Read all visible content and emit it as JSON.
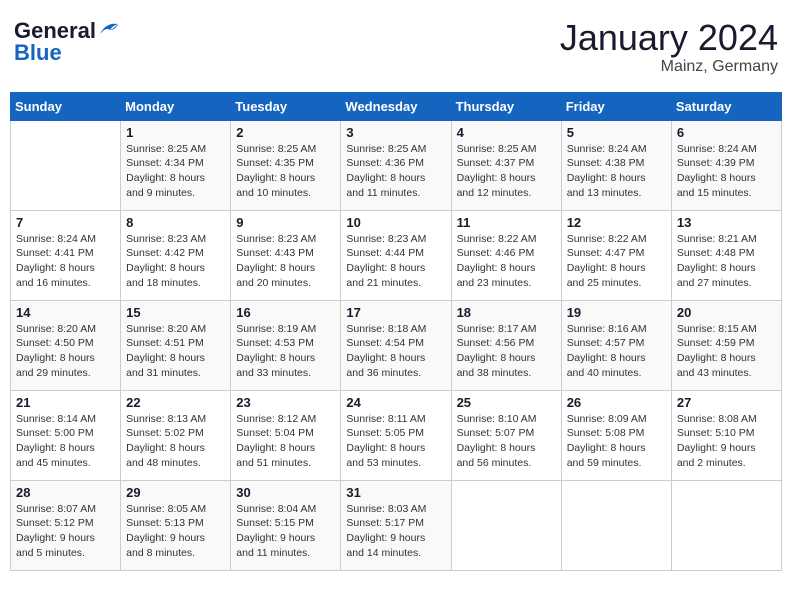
{
  "header": {
    "logo_general": "General",
    "logo_blue": "Blue",
    "month_title": "January 2024",
    "location": "Mainz, Germany"
  },
  "weekdays": [
    "Sunday",
    "Monday",
    "Tuesday",
    "Wednesday",
    "Thursday",
    "Friday",
    "Saturday"
  ],
  "weeks": [
    [
      {
        "day": "",
        "sunrise": "",
        "sunset": "",
        "daylight": ""
      },
      {
        "day": "1",
        "sunrise": "Sunrise: 8:25 AM",
        "sunset": "Sunset: 4:34 PM",
        "daylight": "Daylight: 8 hours and 9 minutes."
      },
      {
        "day": "2",
        "sunrise": "Sunrise: 8:25 AM",
        "sunset": "Sunset: 4:35 PM",
        "daylight": "Daylight: 8 hours and 10 minutes."
      },
      {
        "day": "3",
        "sunrise": "Sunrise: 8:25 AM",
        "sunset": "Sunset: 4:36 PM",
        "daylight": "Daylight: 8 hours and 11 minutes."
      },
      {
        "day": "4",
        "sunrise": "Sunrise: 8:25 AM",
        "sunset": "Sunset: 4:37 PM",
        "daylight": "Daylight: 8 hours and 12 minutes."
      },
      {
        "day": "5",
        "sunrise": "Sunrise: 8:24 AM",
        "sunset": "Sunset: 4:38 PM",
        "daylight": "Daylight: 8 hours and 13 minutes."
      },
      {
        "day": "6",
        "sunrise": "Sunrise: 8:24 AM",
        "sunset": "Sunset: 4:39 PM",
        "daylight": "Daylight: 8 hours and 15 minutes."
      }
    ],
    [
      {
        "day": "7",
        "sunrise": "Sunrise: 8:24 AM",
        "sunset": "Sunset: 4:41 PM",
        "daylight": "Daylight: 8 hours and 16 minutes."
      },
      {
        "day": "8",
        "sunrise": "Sunrise: 8:23 AM",
        "sunset": "Sunset: 4:42 PM",
        "daylight": "Daylight: 8 hours and 18 minutes."
      },
      {
        "day": "9",
        "sunrise": "Sunrise: 8:23 AM",
        "sunset": "Sunset: 4:43 PM",
        "daylight": "Daylight: 8 hours and 20 minutes."
      },
      {
        "day": "10",
        "sunrise": "Sunrise: 8:23 AM",
        "sunset": "Sunset: 4:44 PM",
        "daylight": "Daylight: 8 hours and 21 minutes."
      },
      {
        "day": "11",
        "sunrise": "Sunrise: 8:22 AM",
        "sunset": "Sunset: 4:46 PM",
        "daylight": "Daylight: 8 hours and 23 minutes."
      },
      {
        "day": "12",
        "sunrise": "Sunrise: 8:22 AM",
        "sunset": "Sunset: 4:47 PM",
        "daylight": "Daylight: 8 hours and 25 minutes."
      },
      {
        "day": "13",
        "sunrise": "Sunrise: 8:21 AM",
        "sunset": "Sunset: 4:48 PM",
        "daylight": "Daylight: 8 hours and 27 minutes."
      }
    ],
    [
      {
        "day": "14",
        "sunrise": "Sunrise: 8:20 AM",
        "sunset": "Sunset: 4:50 PM",
        "daylight": "Daylight: 8 hours and 29 minutes."
      },
      {
        "day": "15",
        "sunrise": "Sunrise: 8:20 AM",
        "sunset": "Sunset: 4:51 PM",
        "daylight": "Daylight: 8 hours and 31 minutes."
      },
      {
        "day": "16",
        "sunrise": "Sunrise: 8:19 AM",
        "sunset": "Sunset: 4:53 PM",
        "daylight": "Daylight: 8 hours and 33 minutes."
      },
      {
        "day": "17",
        "sunrise": "Sunrise: 8:18 AM",
        "sunset": "Sunset: 4:54 PM",
        "daylight": "Daylight: 8 hours and 36 minutes."
      },
      {
        "day": "18",
        "sunrise": "Sunrise: 8:17 AM",
        "sunset": "Sunset: 4:56 PM",
        "daylight": "Daylight: 8 hours and 38 minutes."
      },
      {
        "day": "19",
        "sunrise": "Sunrise: 8:16 AM",
        "sunset": "Sunset: 4:57 PM",
        "daylight": "Daylight: 8 hours and 40 minutes."
      },
      {
        "day": "20",
        "sunrise": "Sunrise: 8:15 AM",
        "sunset": "Sunset: 4:59 PM",
        "daylight": "Daylight: 8 hours and 43 minutes."
      }
    ],
    [
      {
        "day": "21",
        "sunrise": "Sunrise: 8:14 AM",
        "sunset": "Sunset: 5:00 PM",
        "daylight": "Daylight: 8 hours and 45 minutes."
      },
      {
        "day": "22",
        "sunrise": "Sunrise: 8:13 AM",
        "sunset": "Sunset: 5:02 PM",
        "daylight": "Daylight: 8 hours and 48 minutes."
      },
      {
        "day": "23",
        "sunrise": "Sunrise: 8:12 AM",
        "sunset": "Sunset: 5:04 PM",
        "daylight": "Daylight: 8 hours and 51 minutes."
      },
      {
        "day": "24",
        "sunrise": "Sunrise: 8:11 AM",
        "sunset": "Sunset: 5:05 PM",
        "daylight": "Daylight: 8 hours and 53 minutes."
      },
      {
        "day": "25",
        "sunrise": "Sunrise: 8:10 AM",
        "sunset": "Sunset: 5:07 PM",
        "daylight": "Daylight: 8 hours and 56 minutes."
      },
      {
        "day": "26",
        "sunrise": "Sunrise: 8:09 AM",
        "sunset": "Sunset: 5:08 PM",
        "daylight": "Daylight: 8 hours and 59 minutes."
      },
      {
        "day": "27",
        "sunrise": "Sunrise: 8:08 AM",
        "sunset": "Sunset: 5:10 PM",
        "daylight": "Daylight: 9 hours and 2 minutes."
      }
    ],
    [
      {
        "day": "28",
        "sunrise": "Sunrise: 8:07 AM",
        "sunset": "Sunset: 5:12 PM",
        "daylight": "Daylight: 9 hours and 5 minutes."
      },
      {
        "day": "29",
        "sunrise": "Sunrise: 8:05 AM",
        "sunset": "Sunset: 5:13 PM",
        "daylight": "Daylight: 9 hours and 8 minutes."
      },
      {
        "day": "30",
        "sunrise": "Sunrise: 8:04 AM",
        "sunset": "Sunset: 5:15 PM",
        "daylight": "Daylight: 9 hours and 11 minutes."
      },
      {
        "day": "31",
        "sunrise": "Sunrise: 8:03 AM",
        "sunset": "Sunset: 5:17 PM",
        "daylight": "Daylight: 9 hours and 14 minutes."
      },
      {
        "day": "",
        "sunrise": "",
        "sunset": "",
        "daylight": ""
      },
      {
        "day": "",
        "sunrise": "",
        "sunset": "",
        "daylight": ""
      },
      {
        "day": "",
        "sunrise": "",
        "sunset": "",
        "daylight": ""
      }
    ]
  ]
}
